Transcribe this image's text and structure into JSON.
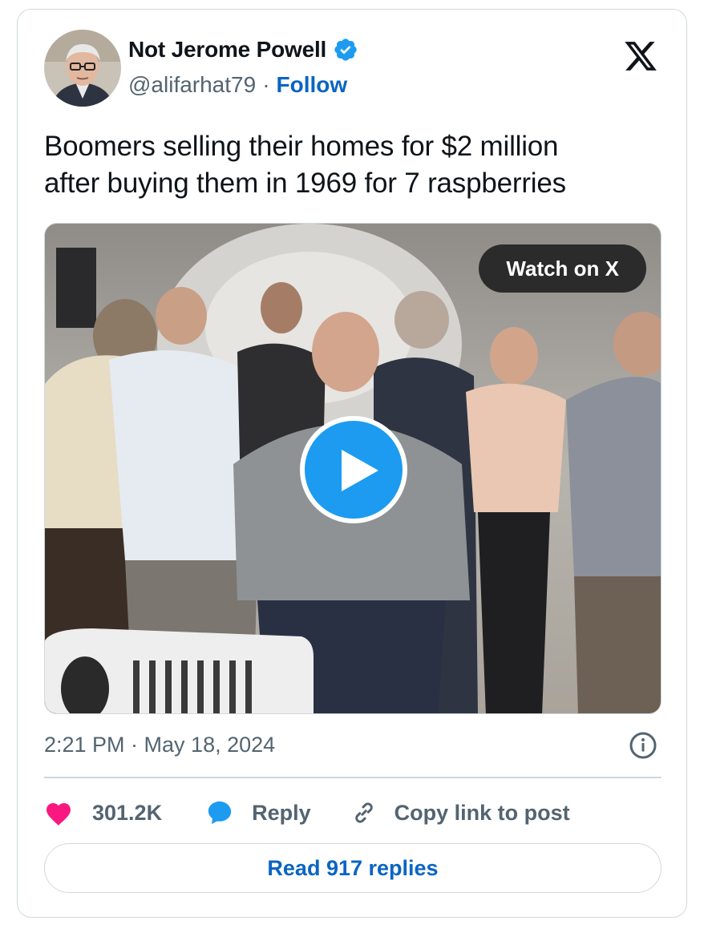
{
  "author": {
    "display_name": "Not Jerome Powell",
    "handle": "@alifarhat79",
    "separator": "·",
    "follow_label": "Follow",
    "verified": true
  },
  "tweet": {
    "text_line1": "Boomers selling their homes for $2 million",
    "text_line2": "after buying them in 1969 for 7 raspberries"
  },
  "media": {
    "watch_label": "Watch on X",
    "type": "video"
  },
  "meta": {
    "timestamp": "2:21 PM · May 18, 2024"
  },
  "actions": {
    "likes": "301.2K",
    "reply_label": "Reply",
    "copy_label": "Copy link to post"
  },
  "read_replies_label": "Read 917 replies",
  "colors": {
    "accent": "#1d9bf0",
    "link": "#0a65c2",
    "like": "#f91880",
    "muted": "#536471",
    "border": "#cfd9de"
  }
}
